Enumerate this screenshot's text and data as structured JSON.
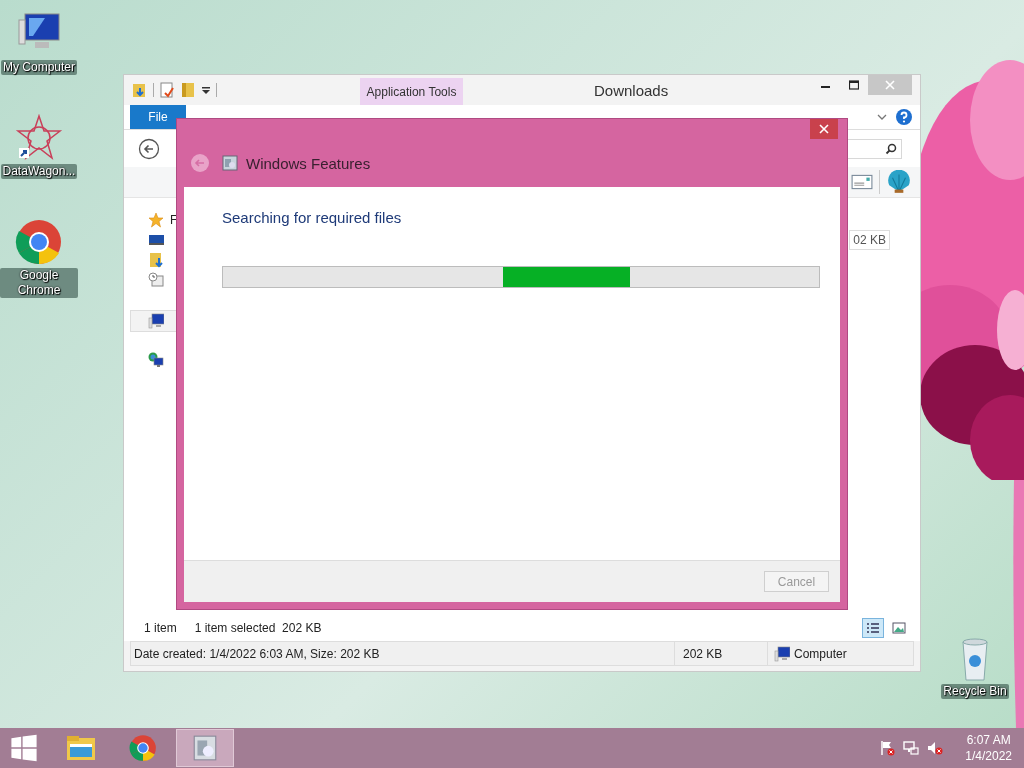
{
  "desktop": {
    "icons": [
      {
        "label": "My Computer",
        "kind": "computer"
      },
      {
        "label": "DataWagon...",
        "kind": "star"
      },
      {
        "label": "Google Chrome",
        "kind": "chrome"
      }
    ],
    "recycle_bin": {
      "label": "Recycle Bin"
    }
  },
  "explorer": {
    "title": "Downloads",
    "context_tab": "Application Tools",
    "ribbon_tabs": [
      {
        "label": "File",
        "kind": "file"
      }
    ],
    "nav": [
      {
        "kind": "favorites",
        "label": "F",
        "selected": false
      },
      {
        "kind": "desktop",
        "selected": false
      },
      {
        "kind": "downloads",
        "selected": false
      },
      {
        "kind": "recent",
        "selected": false
      },
      {
        "kind": "computer",
        "selected": true
      },
      {
        "kind": "network",
        "selected": false
      }
    ],
    "size_cell": "02 KB",
    "status": {
      "count": "1 item",
      "selection": "1 item selected  202 KB"
    },
    "view_buttons": [
      {
        "kind": "details",
        "selected": true
      },
      {
        "kind": "tiles",
        "selected": false
      }
    ],
    "details": {
      "info": "Date created: 1/4/2022 6:03 AM, Size: 202 KB",
      "size": "202 KB",
      "location": "Computer"
    }
  },
  "dialog": {
    "title": "Windows Features",
    "message": "Searching for required files",
    "progress": {
      "indeterminate": true
    },
    "buttons": [
      {
        "label": "Cancel",
        "disabled": true
      }
    ]
  },
  "taskbar": {
    "apps": [
      {
        "kind": "explorer",
        "selected": false
      },
      {
        "kind": "chrome",
        "selected": false
      },
      {
        "kind": "features",
        "selected": true
      }
    ],
    "clock": {
      "time": "6:07 AM",
      "date": "1/4/2022"
    }
  }
}
